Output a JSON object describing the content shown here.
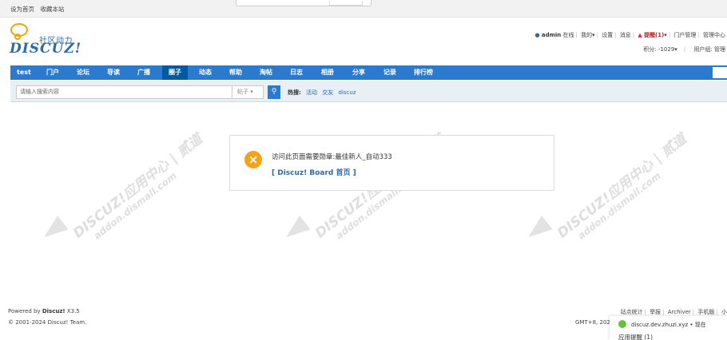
{
  "topbar": {
    "set_home": "设为首页",
    "bookmark": "收藏本站"
  },
  "logo": {
    "cn": "社区动力",
    "en": "DISCUZ!"
  },
  "userbar": {
    "username": "admin",
    "online": "在线",
    "mine": "我的",
    "settings": "设置",
    "messages": "消息",
    "remind": "提醒(1)",
    "portal_admin": "门户管理",
    "admin_center": "管理中心"
  },
  "creditbar": {
    "credits": "积分: -1029",
    "usergroup": "用户组: 管理"
  },
  "nav": {
    "items": [
      "test",
      "门户",
      "论坛",
      "导读",
      "广播",
      "圈子",
      "动态",
      "帮助",
      "淘帖",
      "日志",
      "相册",
      "分享",
      "记录",
      "排行榜"
    ],
    "active_index": 5
  },
  "search": {
    "placeholder": "请输入搜索内容",
    "type": "帖子",
    "hot_label": "热搜:",
    "hot_items": [
      "活动",
      "交友",
      "discuz"
    ]
  },
  "watermark": {
    "line1": "DISCUZ!应用中心 | 贰道",
    "line2": "addon.dismall.com"
  },
  "message": {
    "text": "访问此页面需要勋章:最佳新人_自动333",
    "link": "[ Discuz! Board 首页 ]"
  },
  "footer": {
    "powered_prefix": "Powered by",
    "powered_brand": "Discuz!",
    "version": "X3.5",
    "copyright": "© 2001-2024 Discuz! Team.",
    "links": [
      "站点统计",
      "举报",
      "Archiver",
      "手机版",
      "小"
    ],
    "timezone": "GMT+8, 202"
  },
  "notification": {
    "host": "discuz.dev.zhuzi.xyz",
    "time": "现在",
    "title": "应用提醒 (1)"
  }
}
